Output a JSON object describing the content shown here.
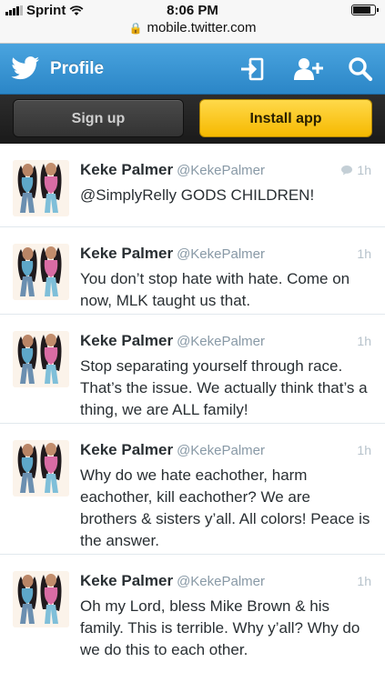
{
  "status_bar": {
    "carrier": "Sprint",
    "time": "8:06 PM",
    "battery_level": 0.85
  },
  "url_bar": {
    "url": "mobile.twitter.com"
  },
  "top_bar": {
    "title": "Profile",
    "icons": [
      "twitter-bird-icon",
      "sign-in-icon",
      "follow-user-icon",
      "search-icon"
    ],
    "color": "#3b96d6"
  },
  "actions": {
    "signup_label": "Sign up",
    "install_label": "Install app",
    "install_color": "#f8c512"
  },
  "tweets": [
    {
      "name": "Keke Palmer",
      "handle": "@KekePalmer",
      "time": "1h",
      "is_reply": true,
      "text": "@SimplyRelly GODS CHILDREN!"
    },
    {
      "name": "Keke Palmer",
      "handle": "@KekePalmer",
      "time": "1h",
      "is_reply": false,
      "text": "You don’t stop hate with hate. Come on now, MLK taught us that."
    },
    {
      "name": "Keke Palmer",
      "handle": "@KekePalmer",
      "time": "1h",
      "is_reply": false,
      "text": "Stop separating yourself through race. That’s the issue. We actually think that’s a thing, we are ALL family!"
    },
    {
      "name": "Keke Palmer",
      "handle": "@KekePalmer",
      "time": "1h",
      "is_reply": false,
      "text": "Why do we hate eachother, harm eachother, kill eachother? We are brothers & sisters y’all. All colors! Peace is the answer."
    },
    {
      "name": "Keke Palmer",
      "handle": "@KekePalmer",
      "time": "1h",
      "is_reply": false,
      "text": "Oh my Lord, bless Mike Brown & his family. This is terrible. Why y’all? Why do we do this to each other."
    }
  ]
}
